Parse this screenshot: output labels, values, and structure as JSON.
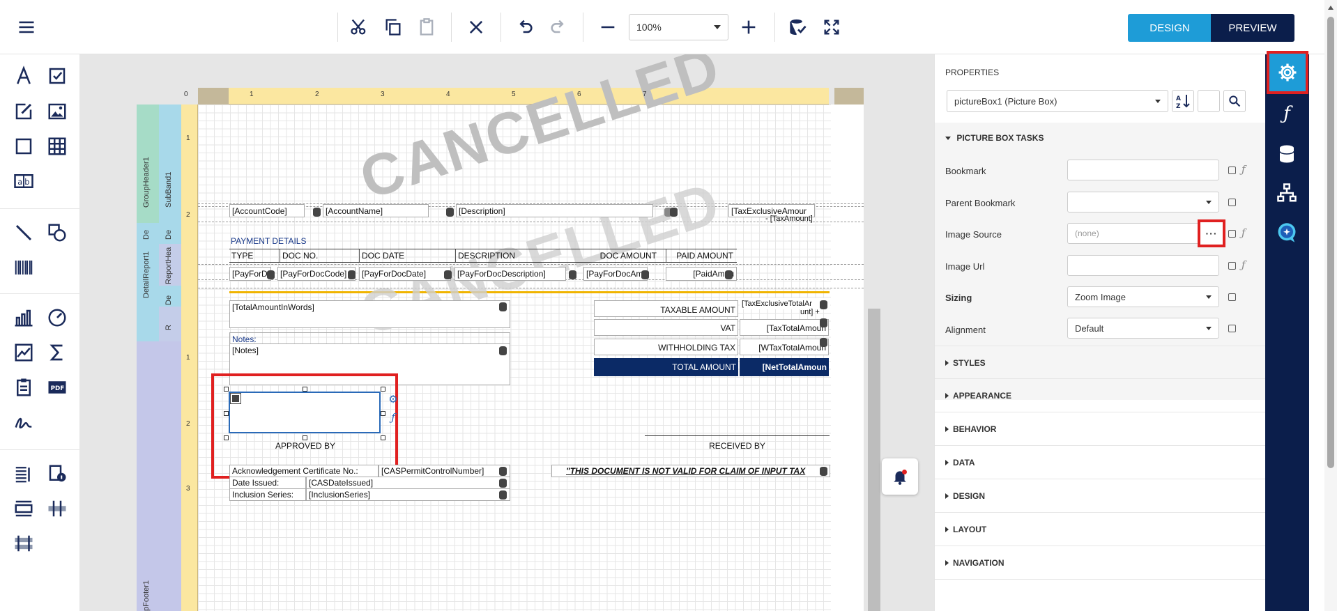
{
  "toolbar": {
    "zoom_value": "100%",
    "design_label": "DESIGN",
    "preview_label": "PREVIEW"
  },
  "left_tools": [
    "text-icon",
    "checkbox-icon",
    "rich-text-icon",
    "image-icon",
    "rectangle-icon",
    "table-icon",
    "textbox-icon",
    "line-icon",
    "shapes-icon",
    "barcode-icon",
    "chart-icon",
    "gauge-icon",
    "sparkline-icon",
    "summary-icon",
    "subreport-icon",
    "pdf-icon",
    "signature-icon",
    "list-icon",
    "info-icon",
    "band-icon",
    "column-icon",
    "crosstab-icon"
  ],
  "ruler": {
    "h": [
      "0",
      "1",
      "2",
      "3",
      "4",
      "5",
      "6",
      "7"
    ],
    "v": [
      "1",
      "2",
      "1",
      "2",
      "3"
    ]
  },
  "bands": {
    "group_header": "GroupHeader1",
    "sub_band": "SubBand1",
    "detail_report": "DetailReport1",
    "report_header": "ReportHea",
    "de1": "De",
    "de2": "De",
    "de3": "De",
    "r": "R",
    "group_footer": "pFooter1"
  },
  "watermark": "CANCELLED",
  "detail_fields": {
    "account_code": "[AccountCode]",
    "account_name": "[AccountName]",
    "description": "[Description]",
    "tax_excl": "[TaxExclusiveAmour",
    "tax_amount": "- [TaxAmount]"
  },
  "payment": {
    "heading": "PAYMENT DETAILS",
    "headers": [
      "TYPE",
      "DOC NO.",
      "DOC DATE",
      "DESCRIPTION",
      "DOC AMOUNT",
      "PAID AMOUNT"
    ],
    "row": [
      "[PayForDo",
      "[PayForDocCode]",
      "[PayForDocDate]",
      "[PayForDocDescription]",
      "[PayForDocAmou",
      "[PaidAmou"
    ]
  },
  "footer": {
    "total_words": "[TotalAmountInWords]",
    "notes_label": "Notes:",
    "notes_field": "[Notes]",
    "taxable_label": "TAXABLE AMOUNT",
    "taxable_value": "[TaxExclusiveTotalAr",
    "taxable_value2": "unt] +",
    "vat_label": "VAT",
    "vat_value": "[TaxTotalAmoun",
    "wht_label": "WITHHOLDING TAX",
    "wht_value": "[WTaxTotalAmoun",
    "total_label": "TOTAL AMOUNT",
    "total_value": "[NetTotalAmoun",
    "approved_by": "APPROVED BY",
    "received_by": "RECEIVED BY",
    "ack_label": "Acknowledgement Certificate No.:",
    "ack_value": "[CASPermitControlNumber]",
    "date_label": "Date Issued:",
    "date_value": "[CASDateIssued]",
    "series_label": "Inclusion Series:",
    "series_value": "[InclusionSeries]",
    "disclaimer": "\"THIS DOCUMENT IS NOT VALID FOR CLAIM OF INPUT TAX"
  },
  "properties": {
    "title": "PROPERTIES",
    "selected_component": "pictureBox1 (Picture Box)",
    "tasks_title": "PICTURE BOX TASKS",
    "rows": {
      "bookmark": "Bookmark",
      "parent_bookmark": "Parent Bookmark",
      "image_source": "Image Source",
      "image_source_value": "(none)",
      "image_url": "Image Url",
      "sizing": "Sizing",
      "sizing_value": "Zoom Image",
      "alignment": "Alignment",
      "alignment_value": "Default"
    },
    "sections": [
      "STYLES",
      "APPEARANCE",
      "BEHAVIOR",
      "DATA",
      "DESIGN",
      "LAYOUT",
      "NAVIGATION"
    ]
  },
  "colors": {
    "accent": "#1e9cd7",
    "dark_navy": "#0b1e4b",
    "highlight_red": "#e02020",
    "ruler_yellow": "#fbe7a0",
    "total_row_bg": "#0b2a66"
  }
}
